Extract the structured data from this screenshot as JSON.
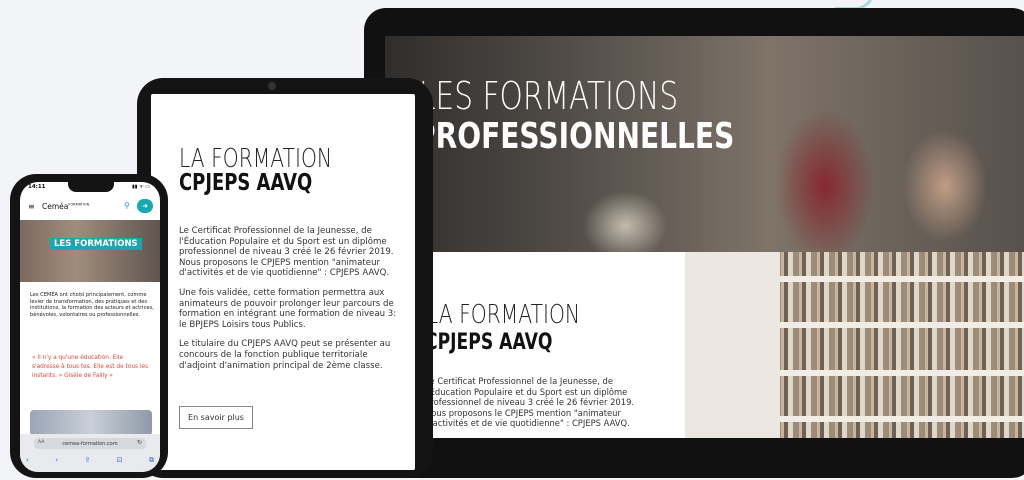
{
  "laptop": {
    "hero_line1": "LES FORMATIONS",
    "hero_line2": "PROFESSIONNELLES",
    "section_title1": "LA FORMATION",
    "section_title2": "CPJEPS AAVQ",
    "body": "Le Certificat Professionnel de la Jeunesse, de l'Éducation Populaire et du Sport est un diplôme professionnel de niveau 3 créé le 26 février 2019. Nous proposons le CPJEPS mention \"animateur d'activités et de vie quotidienne\" : CPJEPS AAVQ."
  },
  "tablet": {
    "title1": "LA FORMATION",
    "title2": "CPJEPS AAVQ",
    "para1": "Le Certificat Professionnel de la Jeunesse, de l'Éducation Populaire et du Sport est un diplôme professionnel de niveau 3 créé le 26 février 2019. Nous proposons le CPJEPS mention \"animateur d'activités et de vie quotidienne\" : CPJEPS AAVQ.",
    "para2": "Une fois validée, cette formation permettra aux animateurs de pouvoir prolonger leur parcours de formation en intégrant une formation de niveau 3: le BPJEPS Loisirs tous Publics.",
    "para3": "Le titulaire du CPJEPS AAVQ peut se présenter au concours de la fonction publique territoriale d'adjoint d'animation principal de 2ème classe.",
    "button": "En savoir plus"
  },
  "phone": {
    "time": "14:11",
    "status_icons": "▮▮ ᯤ ▭",
    "menu_icon": "≡",
    "logo": "Ceméa",
    "logo_sup": "FORMATION",
    "search_icon": "⚲",
    "login_icon": "➜",
    "hero_label": "LES FORMATIONS",
    "intro": "Les CEMÉA ont choisi principalement, comme levier de transformation, des pratiques et des institutions, la formation des acteurs et actrices, bénévoles, volontaires ou professionnelles.",
    "quote": "« Il n'y a qu'une éducation. Elle s'adresse à tous·tes. Elle est de tous les instants. » Gisèle de Failly »",
    "url_aa": "AA",
    "url": "cemea-formation.com",
    "reload": "↻",
    "tools": [
      "‹",
      "›",
      "⇪",
      "⊡",
      "⧉"
    ]
  },
  "colors": {
    "accent": "#19a7b0",
    "quote": "#e0473d",
    "background": "#f3f4f8"
  }
}
